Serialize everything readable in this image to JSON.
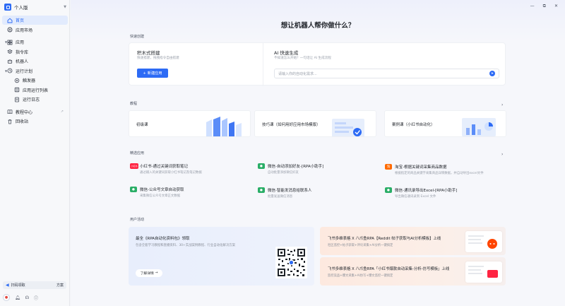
{
  "workspace": {
    "name": "个人版"
  },
  "nav": {
    "home": "首页",
    "market": "应用市场",
    "apps": "应用",
    "commands": "指令库",
    "robots": "机器人",
    "plans": "运行计划",
    "triggers": "触发器",
    "run_list": "应用运行列表",
    "run_log": "运行日志",
    "tutorial": "教程中心",
    "recycle": "回收站"
  },
  "sidebar_footer": {
    "scan_label": "扫码领取",
    "scan_right": "方案"
  },
  "hero": {
    "title": "想让机器人帮你做什么？"
  },
  "quick_create": {
    "section": "快速创建",
    "left_title": "积木式搭建",
    "left_sub": "快速搭建，拖拽指令自由搭建",
    "new_button": "新建应用",
    "right_title": "AI 快速生成",
    "right_sub": "不知道怎么开始？一句话让 AI 生成流程",
    "input_placeholder": "请输入你的自动化需求..."
  },
  "tutorials": {
    "section": "教程",
    "items": [
      {
        "label": "初级课"
      },
      {
        "label": "技巧课（如何用好应用市场模版）"
      },
      {
        "label": "案例课（小红书自动化）"
      }
    ]
  },
  "featured": {
    "section": "精选应用",
    "items": [
      {
        "title": "小红书-通过关键词获取笔记",
        "desc": "通过输入的关键词获取小红书笔记及笔记数据",
        "icon": "xhs-icon",
        "color": "#ff2442",
        "badge": "小红书"
      },
      {
        "title": "微信-自动添加好友-[RPA小助手]",
        "desc": "自动批量添加微信好友",
        "icon": "wechat-icon",
        "color": "#2aae67",
        "badge": "●"
      },
      {
        "title": "淘宝-根据关键词采集商品数据",
        "desc": "根据指定的商品关键字采集商品详情数据，并自动导出excel文件",
        "icon": "taobao-icon",
        "color": "#ff6a00",
        "badge": "淘"
      },
      {
        "title": "微信-公众号文章自动获取",
        "desc": "采集微信公众号文章正文数据",
        "icon": "wechat-icon",
        "color": "#2aae67",
        "badge": "●"
      },
      {
        "title": "微信-智能发消息给联系人",
        "desc": "批量发送微信消息",
        "icon": "wechat-icon",
        "color": "#2aae67",
        "badge": "●"
      },
      {
        "title": "微信-通讯录导出Excel-[RPA小助手]",
        "desc": "导出微信通讯录到 Excel 文件",
        "icon": "wechat-icon",
        "color": "#2aae67",
        "badge": "●"
      }
    ]
  },
  "activities": {
    "section": "用户活动",
    "main_title": "最全《RPA自动化资料包》领取",
    "main_desc": "包含全套学习教程和直播资料、30+实战案例教程、行业自动化解决方案",
    "main_button": "了解详情",
    "cards": [
      {
        "title": "飞书多维表格 X 八爪鱼RPA【Reddit 帖子获取与AI分析模板】上线",
        "desc": "社区监控+帖子获取+评论采集+AI分析一键搞定"
      },
      {
        "title": "飞书多维表格 X 八爪鱼RPA「小红书爆款自动采集-分析-仿写模板」上线",
        "desc": "监控竞品+爆文采集+AI仿写+爆文监控一键搞定"
      }
    ]
  },
  "colors": {
    "accent": "#2d6bf5",
    "active_bg": "#e2ebfd"
  }
}
